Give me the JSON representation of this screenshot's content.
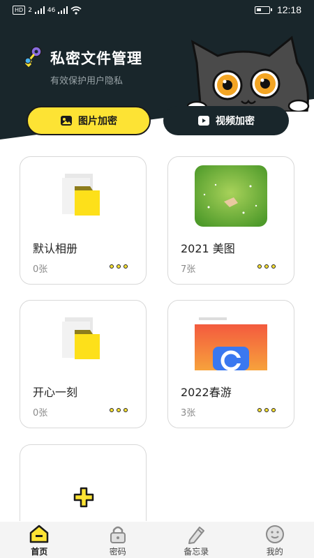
{
  "status_bar": {
    "left_badge": "HD",
    "sim": "2",
    "network": "46",
    "time": "12:18"
  },
  "header": {
    "title": "私密文件管理",
    "subtitle": "有效保护用户隐私",
    "colors": {
      "dark": "#19262b",
      "accent": "#fde334"
    }
  },
  "tabs": [
    {
      "label": "图片加密",
      "icon": "image-icon",
      "active": true
    },
    {
      "label": "视频加密",
      "icon": "video-icon",
      "active": false
    }
  ],
  "albums": [
    {
      "name": "默认相册",
      "count": "0张",
      "thumb": "folder-icon"
    },
    {
      "name": "2021 美图",
      "count": "7张",
      "thumb": "green-grass-photo"
    },
    {
      "name": "开心一刻",
      "count": "0张",
      "thumb": "folder-icon"
    },
    {
      "name": "2022春游",
      "count": "3张",
      "thumb": "app-screenshot-photo"
    }
  ],
  "add_album": {
    "icon": "plus-icon"
  },
  "bottom_nav": [
    {
      "label": "首页",
      "icon": "home-icon",
      "active": true
    },
    {
      "label": "密码",
      "icon": "lock-icon",
      "active": false
    },
    {
      "label": "备忘录",
      "icon": "pencil-icon",
      "active": false
    },
    {
      "label": "我的",
      "icon": "smiley-icon",
      "active": false
    }
  ]
}
